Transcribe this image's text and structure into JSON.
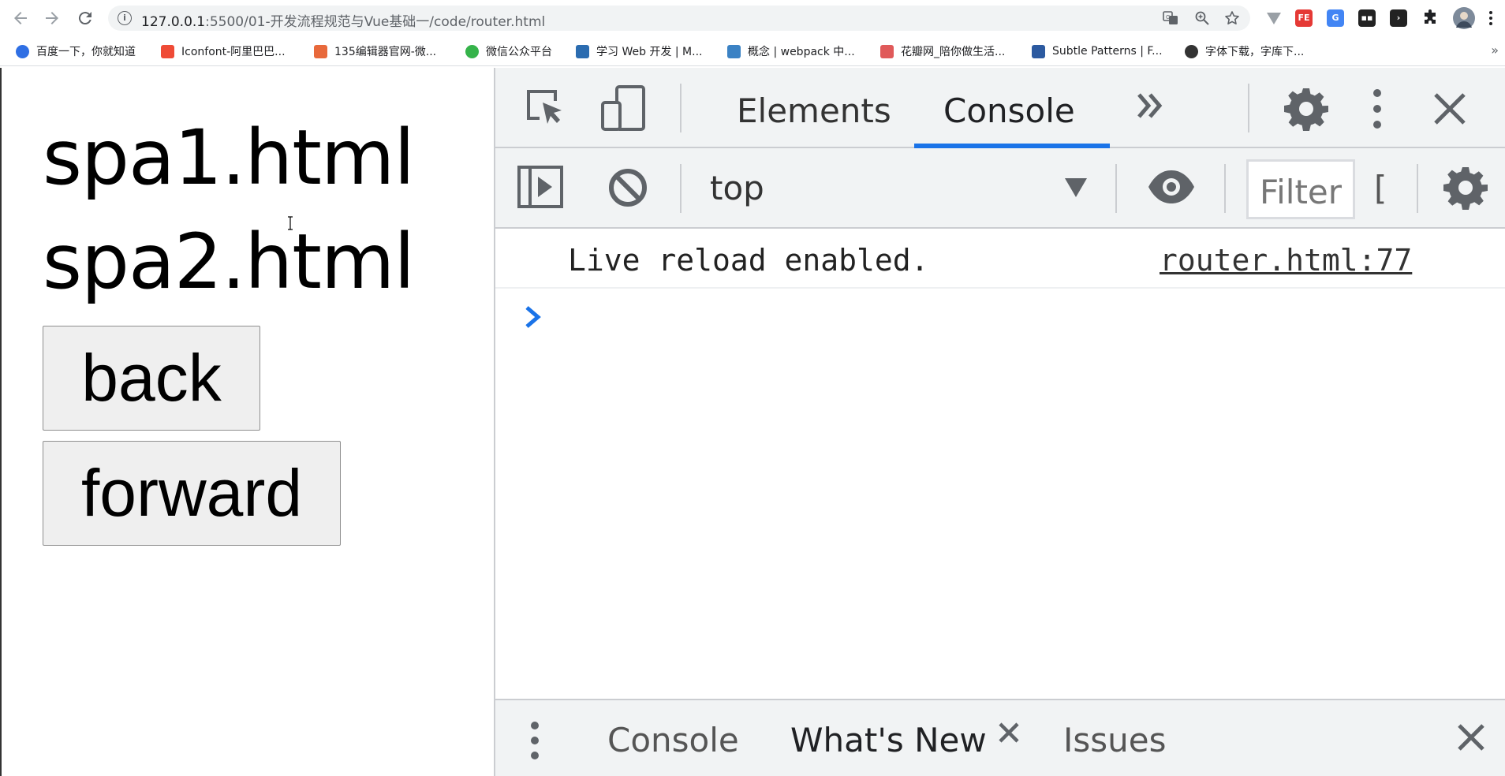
{
  "browser": {
    "url_host": "127.0.0.1",
    "url_path": ":5500/01-开发流程规范与Vue基础一/code/router.html",
    "bookmarks": [
      {
        "label": "百度一下，你就知道",
        "color": "#2f6fe4"
      },
      {
        "label": "Iconfont-阿里巴巴...",
        "color": "#ef4b36"
      },
      {
        "label": "135编辑器官网-微...",
        "color": "#e8693b"
      },
      {
        "label": "微信公众平台",
        "color": "#35b34a"
      },
      {
        "label": "学习 Web 开发 | M...",
        "color": "#2b6cb0"
      },
      {
        "label": "概念 | webpack 中...",
        "color": "#3b82c4"
      },
      {
        "label": "花瓣网_陪你做生活...",
        "color": "#e05a5a"
      },
      {
        "label": "Subtle Patterns | F...",
        "color": "#2c5aa0"
      },
      {
        "label": "字体下载，字库下...",
        "color": "#333333"
      }
    ],
    "extensions": [
      {
        "label": "FE",
        "color": "#e53935"
      },
      {
        "label": "G",
        "color": "#4285f4"
      },
      {
        "label": "▪▪",
        "color": "#222222"
      },
      {
        "label": "›",
        "color": "#222222"
      }
    ]
  },
  "page": {
    "line1": "spa1.html",
    "line2": "spa2.html",
    "back_label": "back",
    "forward_label": "forward"
  },
  "devtools": {
    "tabs": [
      "Elements",
      "Console"
    ],
    "active_tab": "Console",
    "context": "top",
    "filter_placeholder": "Filter",
    "filter_clip": "[",
    "log_message": "Live reload enabled.",
    "log_source": "router.html:77",
    "drawer_tabs": [
      "Console",
      "What's New",
      "Issues"
    ],
    "accent_color": "#1a73e8"
  }
}
